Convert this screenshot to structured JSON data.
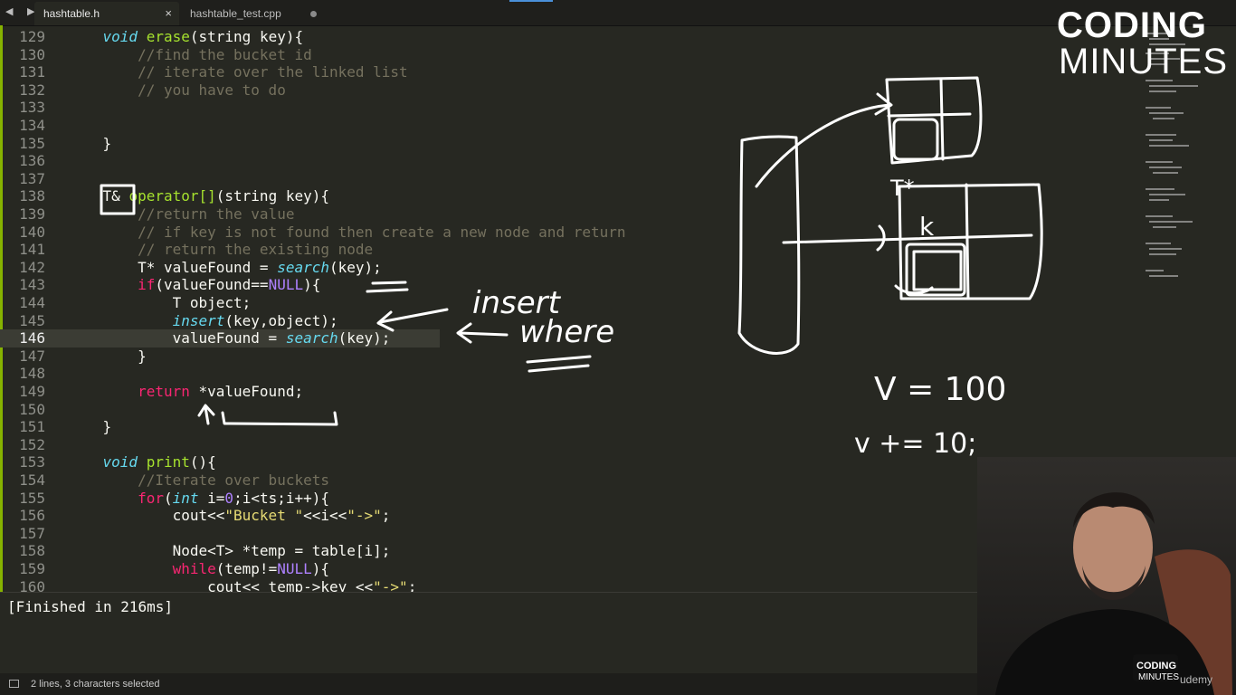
{
  "tabs": [
    {
      "label": "hashtable.h",
      "active": true,
      "close": "×"
    },
    {
      "label": "hashtable_test.cpp",
      "active": false
    }
  ],
  "nav_arrows": "◀ ▶",
  "code": {
    "current_line": 146,
    "lines": [
      {
        "n": "129",
        "tokens": [
          [
            "plain",
            "    "
          ],
          [
            "type",
            "void"
          ],
          [
            "plain",
            " "
          ],
          [
            "fn",
            "erase"
          ],
          [
            "plain",
            "(string key){"
          ]
        ]
      },
      {
        "n": "130",
        "tokens": [
          [
            "plain",
            "        "
          ],
          [
            "cm",
            "//find the bucket id"
          ]
        ]
      },
      {
        "n": "131",
        "tokens": [
          [
            "plain",
            "        "
          ],
          [
            "cm",
            "// iterate over the linked list"
          ]
        ]
      },
      {
        "n": "132",
        "tokens": [
          [
            "plain",
            "        "
          ],
          [
            "cm",
            "// you have to do"
          ]
        ]
      },
      {
        "n": "133",
        "tokens": []
      },
      {
        "n": "134",
        "tokens": []
      },
      {
        "n": "135",
        "tokens": [
          [
            "plain",
            "    }"
          ]
        ]
      },
      {
        "n": "136",
        "tokens": []
      },
      {
        "n": "137",
        "tokens": []
      },
      {
        "n": "138",
        "tokens": [
          [
            "plain",
            "    T& "
          ],
          [
            "fn",
            "operator[]"
          ],
          [
            "plain",
            "(string key){"
          ]
        ]
      },
      {
        "n": "139",
        "tokens": [
          [
            "plain",
            "        "
          ],
          [
            "cm",
            "//return the value"
          ]
        ]
      },
      {
        "n": "140",
        "tokens": [
          [
            "plain",
            "        "
          ],
          [
            "cm",
            "// if key is not found then create a new node and return"
          ]
        ]
      },
      {
        "n": "141",
        "tokens": [
          [
            "plain",
            "        "
          ],
          [
            "cm",
            "// return the existing node"
          ]
        ]
      },
      {
        "n": "142",
        "tokens": [
          [
            "plain",
            "        T* valueFound = "
          ],
          [
            "type",
            "search"
          ],
          [
            "plain",
            "(key);"
          ]
        ]
      },
      {
        "n": "143",
        "tokens": [
          [
            "plain",
            "        "
          ],
          [
            "kw",
            "if"
          ],
          [
            "plain",
            "(valueFound=="
          ],
          [
            "const",
            "NULL"
          ],
          [
            "plain",
            "){"
          ]
        ]
      },
      {
        "n": "144",
        "tokens": [
          [
            "plain",
            "            T object;"
          ]
        ]
      },
      {
        "n": "145",
        "tokens": [
          [
            "plain",
            "            "
          ],
          [
            "type",
            "insert"
          ],
          [
            "plain",
            "(key,object);"
          ]
        ]
      },
      {
        "n": "146",
        "tokens": [
          [
            "plain",
            "            valueFound = "
          ],
          [
            "type",
            "search"
          ],
          [
            "plain",
            "(key);"
          ]
        ]
      },
      {
        "n": "147",
        "tokens": [
          [
            "plain",
            "        }"
          ]
        ]
      },
      {
        "n": "148",
        "tokens": []
      },
      {
        "n": "149",
        "tokens": [
          [
            "plain",
            "        "
          ],
          [
            "kw",
            "return"
          ],
          [
            "plain",
            " *valueFound;"
          ]
        ]
      },
      {
        "n": "150",
        "tokens": []
      },
      {
        "n": "151",
        "tokens": [
          [
            "plain",
            "    }"
          ]
        ]
      },
      {
        "n": "152",
        "tokens": []
      },
      {
        "n": "153",
        "tokens": [
          [
            "plain",
            "    "
          ],
          [
            "type",
            "void"
          ],
          [
            "plain",
            " "
          ],
          [
            "fn",
            "print"
          ],
          [
            "plain",
            "(){"
          ]
        ]
      },
      {
        "n": "154",
        "tokens": [
          [
            "plain",
            "        "
          ],
          [
            "cm",
            "//Iterate over buckets"
          ]
        ]
      },
      {
        "n": "155",
        "tokens": [
          [
            "plain",
            "        "
          ],
          [
            "kw",
            "for"
          ],
          [
            "plain",
            "("
          ],
          [
            "type",
            "int"
          ],
          [
            "plain",
            " i="
          ],
          [
            "num",
            "0"
          ],
          [
            "plain",
            ";i<ts;i++){"
          ]
        ]
      },
      {
        "n": "156",
        "tokens": [
          [
            "plain",
            "            cout<<"
          ],
          [
            "str",
            "\"Bucket \""
          ],
          [
            "plain",
            "<<i<<"
          ],
          [
            "str",
            "\"->\""
          ],
          [
            "plain",
            ";"
          ]
        ]
      },
      {
        "n": "157",
        "tokens": []
      },
      {
        "n": "158",
        "tokens": [
          [
            "plain",
            "            Node<T> *temp = table[i];"
          ]
        ]
      },
      {
        "n": "159",
        "tokens": [
          [
            "plain",
            "            "
          ],
          [
            "kw",
            "while"
          ],
          [
            "plain",
            "(temp!="
          ],
          [
            "const",
            "NULL"
          ],
          [
            "plain",
            "){"
          ]
        ]
      },
      {
        "n": "160",
        "tokens": [
          [
            "plain",
            "                cout<< temp->key <<"
          ],
          [
            "str",
            "\"->\""
          ],
          [
            "plain",
            ";"
          ]
        ]
      }
    ]
  },
  "output": {
    "text": "[Finished in 216ms]"
  },
  "status": {
    "text": "2 lines, 3 characters selected"
  },
  "logo": {
    "top": "CODING",
    "bottom": "MINUTES"
  },
  "annotations": {
    "insert": "insert",
    "where": "where",
    "k": "k",
    "tx": "T*",
    "v_eq": "V = 100",
    "v_plus": "v += 10;"
  },
  "watermark": "udemy",
  "colors": {
    "editor_bg": "#272822",
    "keyword": "#f92672",
    "type": "#66d9ef",
    "function": "#a6e22e",
    "comment": "#75715e",
    "string": "#e6db74",
    "number": "#ae81ff",
    "ink": "#ffffff"
  }
}
